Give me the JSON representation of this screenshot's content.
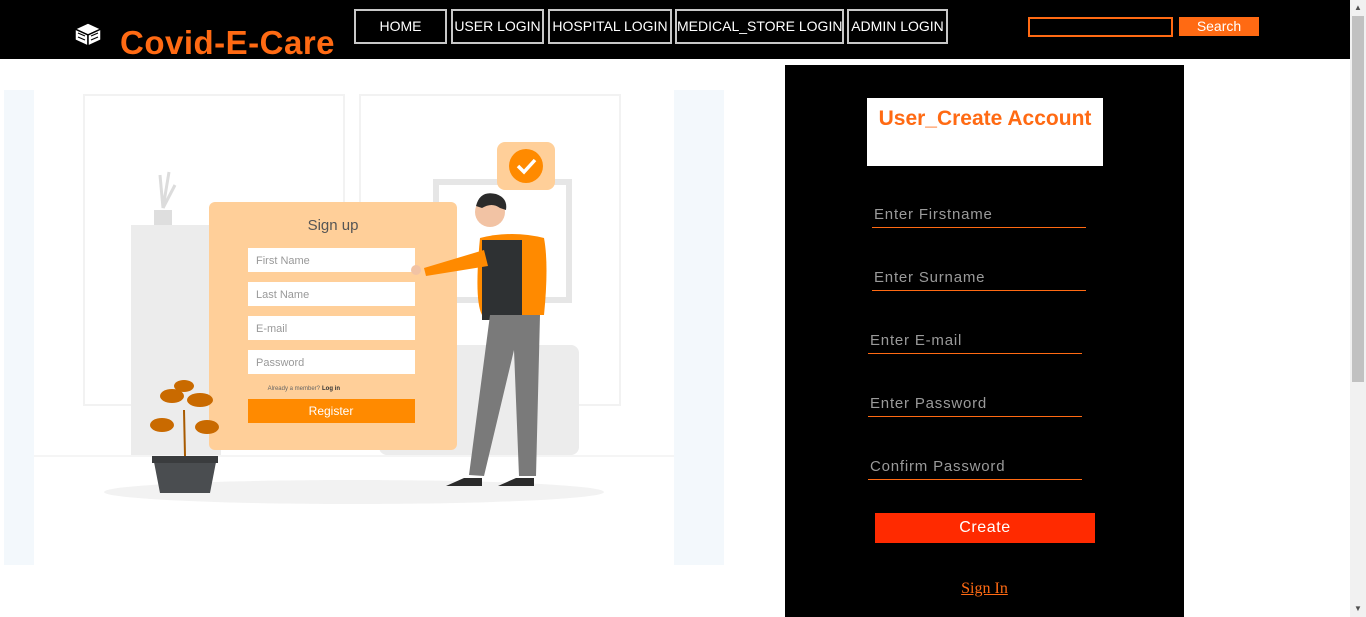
{
  "header": {
    "brand": "Covid-E-Care",
    "logo_icon": "cube-stack-icon",
    "nav": [
      {
        "label": "HOME"
      },
      {
        "label": "USER LOGIN"
      },
      {
        "label": "HOSPITAL LOGIN"
      },
      {
        "label": "MEDICAL_STORE LOGIN"
      },
      {
        "label": "ADMIN LOGIN"
      }
    ],
    "search": {
      "value": "",
      "button_label": "Search"
    }
  },
  "illustration": {
    "heading": "Sign up",
    "fields": [
      "First Name",
      "Last Name",
      "E-mail",
      "Password"
    ],
    "member_text": "Already a member?",
    "login_text": "Log in",
    "register_label": "Register"
  },
  "form": {
    "title": "User_Create Account",
    "fields": [
      {
        "placeholder": "Enter Firstname"
      },
      {
        "placeholder": "Enter Surname"
      },
      {
        "placeholder": "Enter E-mail"
      },
      {
        "placeholder": "Enter Password"
      },
      {
        "placeholder": "Confirm Password"
      }
    ],
    "create_label": "Create",
    "signin_label": "Sign In"
  },
  "colors": {
    "accent": "#ff6a13",
    "create": "#ff2a00",
    "bar": "#000000"
  }
}
